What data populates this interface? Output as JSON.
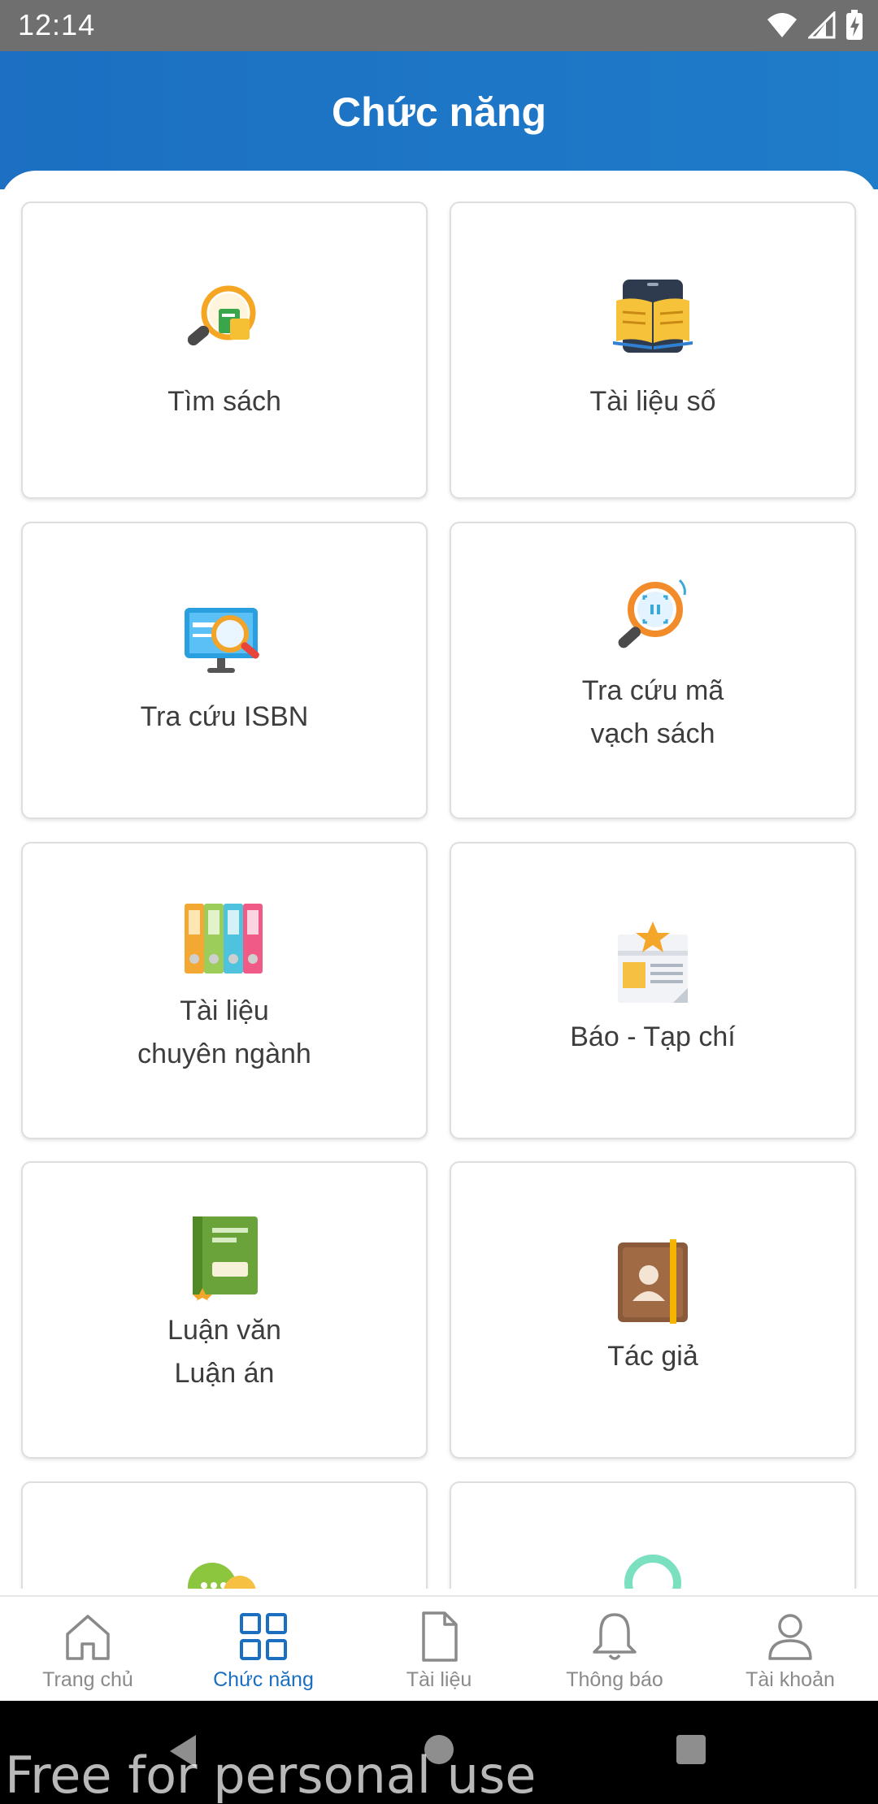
{
  "status_bar": {
    "time": "12:14",
    "icons": [
      "wifi-icon",
      "signal-icon",
      "battery-charging-icon"
    ]
  },
  "header": {
    "title": "Chức năng",
    "color": "#1f74c5"
  },
  "cards": [
    {
      "label": "Tìm sách",
      "icon": "search-books-icon"
    },
    {
      "label": "Tài liệu số",
      "icon": "digital-document-icon"
    },
    {
      "label": "Tra cứu ISBN",
      "icon": "isbn-lookup-icon"
    },
    {
      "label": "Tra cứu mã\nvạch sách",
      "icon": "barcode-lookup-icon"
    },
    {
      "label": "Tài liệu\nchuyên ngành",
      "icon": "binders-icon"
    },
    {
      "label": "Báo - Tạp chí",
      "icon": "newspaper-icon"
    },
    {
      "label": "Luận văn\nLuận án",
      "icon": "thesis-book-icon"
    },
    {
      "label": "Tác giả",
      "icon": "author-book-icon"
    },
    {
      "label": "",
      "icon": "chat-icon"
    },
    {
      "label": "",
      "icon": "ring-icon"
    }
  ],
  "bottom_nav": {
    "active_color": "#1a6fc0",
    "items": [
      {
        "label": "Trang chủ",
        "icon": "home-icon"
      },
      {
        "label": "Chức năng",
        "icon": "grid-icon"
      },
      {
        "label": "Tài liệu",
        "icon": "document-icon"
      },
      {
        "label": "Thông báo",
        "icon": "bell-icon"
      },
      {
        "label": "Tài khoản",
        "icon": "user-icon"
      }
    ]
  },
  "watermark": "Free for personal use"
}
